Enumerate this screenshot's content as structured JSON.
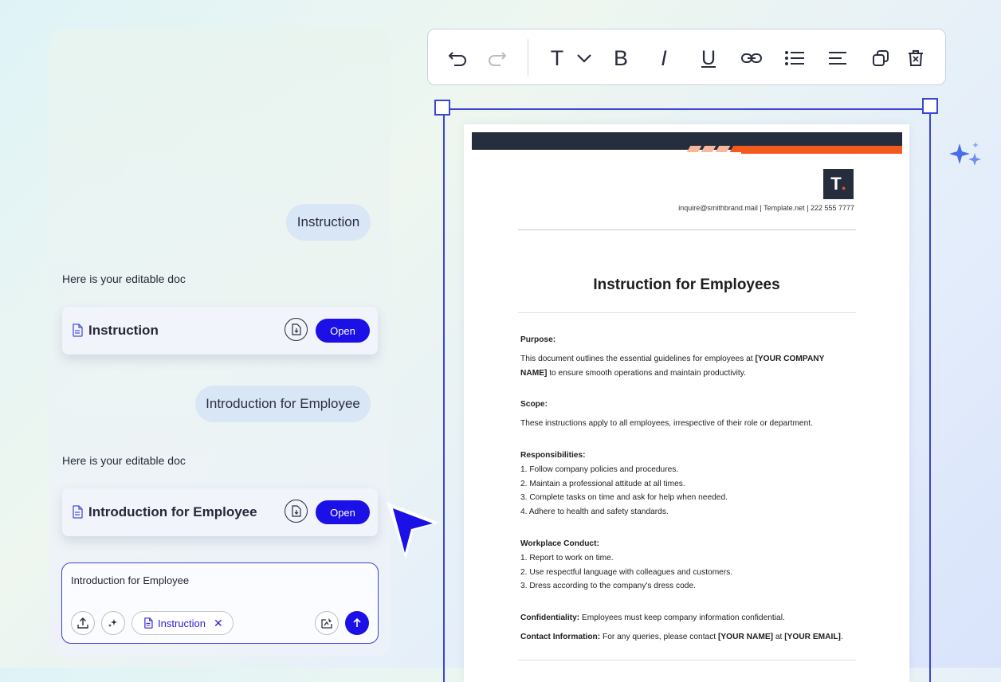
{
  "chat": {
    "messages": [
      {
        "user_prompt": "Instruction",
        "reply": "Here is your editable doc",
        "doc_title": "Instruction",
        "open_label": "Open"
      },
      {
        "user_prompt": "Introduction for Employee",
        "reply": "Here is your editable doc",
        "doc_title": "Introduction for Employee",
        "open_label": "Open"
      }
    ],
    "composer": {
      "value": "Introduction for Employee",
      "chip_label": "Instruction",
      "chip_close": "✕"
    }
  },
  "toolbar": {
    "icons": [
      "undo-icon",
      "redo-icon",
      "text-style-icon",
      "chevron-down-icon",
      "bold-icon",
      "italic-icon",
      "underline-icon",
      "link-icon",
      "bullet-list-icon",
      "align-icon",
      "duplicate-icon",
      "delete-icon"
    ],
    "text_glyph": "T",
    "bold_glyph": "B",
    "italic_glyph": "I",
    "underline_glyph": "U"
  },
  "document": {
    "logo_letter": "T",
    "logo_dot": ".",
    "contact_line": "inquire@smithbrand.mail  |  Template.net  |  222 555 7777",
    "title": "Instruction for Employees",
    "purpose_heading": "Purpose:",
    "purpose_text_1": "This document outlines the essential guidelines for employees at ",
    "purpose_placeholder": "[YOUR COMPANY NAME]",
    "purpose_text_2": " to ensure smooth operations and maintain productivity.",
    "scope_heading": "Scope:",
    "scope_text": "These instructions apply to all employees, irrespective of their role or department.",
    "responsibilities_heading": "Responsibilities:",
    "responsibilities": [
      "1. Follow company policies and procedures.",
      "2. Maintain a professional attitude at all times.",
      "3. Complete tasks on time and ask for help when needed.",
      "4. Adhere to health and safety standards."
    ],
    "conduct_heading": "Workplace Conduct:",
    "conduct": [
      "1. Report to work on time.",
      "2. Use respectful language with colleagues and customers.",
      "3. Dress according to the company's dress code."
    ],
    "confidentiality_heading": "Confidentiality:",
    "confidentiality_text": " Employees must keep company information confidential.",
    "contact_heading": "Contact Information:",
    "contact_text_1": " For any queries, please contact ",
    "contact_name": "[YOUR NAME]",
    "contact_text_2": " at ",
    "contact_email": "[YOUR EMAIL]",
    "contact_text_3": "."
  },
  "colors": {
    "accent": "#1b10e6",
    "selection": "#3b45d6",
    "doc_dark": "#262d3d",
    "doc_orange": "#f45a1d"
  }
}
